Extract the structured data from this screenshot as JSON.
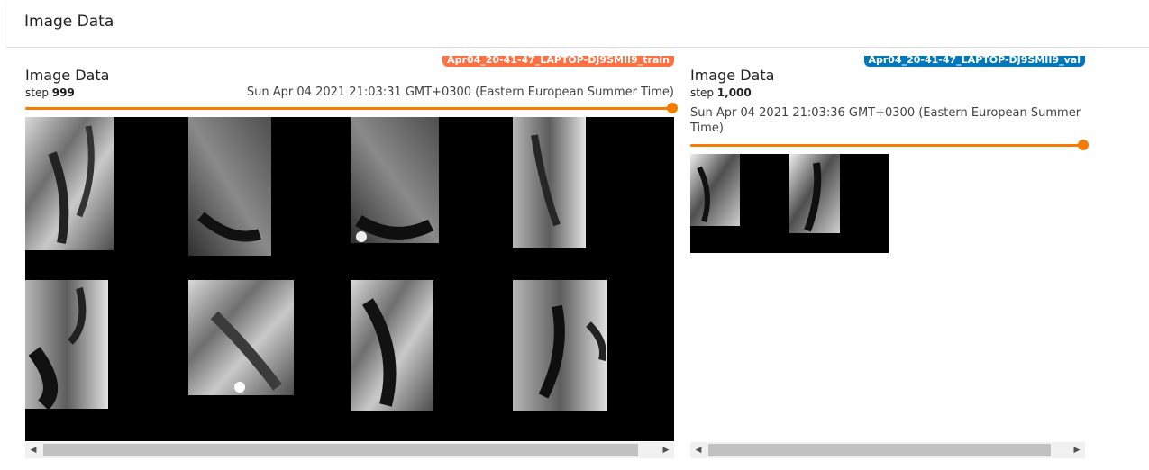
{
  "section": {
    "title": "Image Data"
  },
  "cards": [
    {
      "title": "Image Data",
      "step_label": "step",
      "step_value": "999",
      "timestamp": "Sun Apr 04 2021 21:03:31 GMT+0300 (Eastern European Summer Time)",
      "run_name": "Apr04_20-41-47_LAPTOP-DJ9SMII9_train",
      "run_color": "#ff7043",
      "slider_color": "#f57c00"
    },
    {
      "title": "Image Data",
      "step_label": "step",
      "step_value": "1,000",
      "timestamp": "Sun Apr 04 2021 21:03:36 GMT+0300 (Eastern European Summer Time)",
      "run_name": "Apr04_20-41-47_LAPTOP-DJ9SMII9_val",
      "run_color": "#0077bb",
      "slider_color": "#f57c00"
    }
  ],
  "scrollbar": {
    "left_arrow": "◀",
    "right_arrow": "▶"
  }
}
